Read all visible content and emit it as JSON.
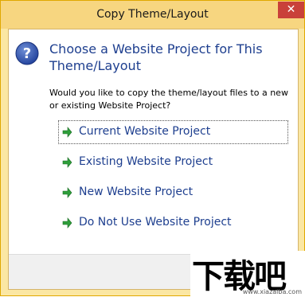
{
  "window": {
    "title": "Copy Theme/Layout",
    "close_glyph": "✕"
  },
  "dialog": {
    "icon": "question-icon",
    "heading": "Choose a Website Project for This Theme/Layout",
    "prompt": "Would you like to copy the theme/layout files to a new or existing Website Project?",
    "options": [
      {
        "label": "Current Website Project",
        "selected": true
      },
      {
        "label": "Existing Website Project",
        "selected": false
      },
      {
        "label": "New Website Project",
        "selected": false
      },
      {
        "label": "Do Not Use Website Project",
        "selected": false
      }
    ]
  },
  "watermark": {
    "text": "下载吧",
    "url": "www.xiazaiba.com"
  },
  "colors": {
    "title_bar": "#f7d680",
    "link_blue": "#1e3f8f",
    "arrow_green": "#2e9e3a",
    "close_red": "#c9413a"
  }
}
